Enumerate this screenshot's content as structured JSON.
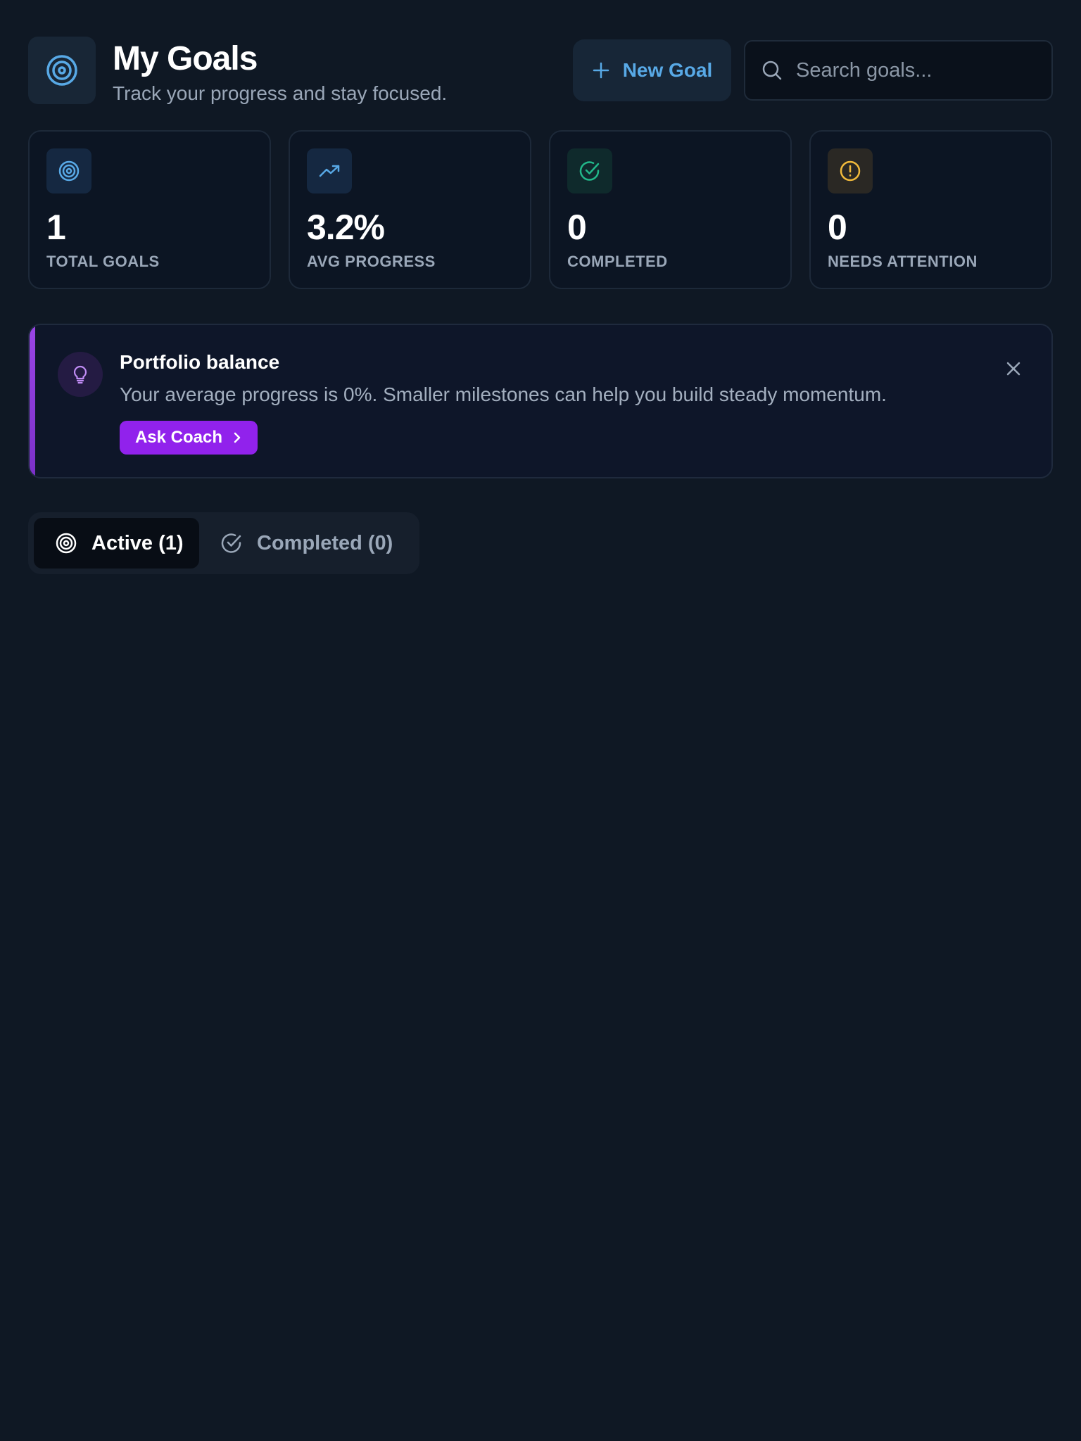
{
  "header": {
    "title": "My Goals",
    "subtitle": "Track your progress and stay focused.",
    "logo_icon": "target-icon",
    "new_goal_label": "New Goal",
    "search_placeholder": "Search goals..."
  },
  "stats": [
    {
      "icon": "target-icon",
      "value": "1",
      "label": "TOTAL GOALS",
      "color": "#58a9e6"
    },
    {
      "icon": "trending-up-icon",
      "value": "3.2%",
      "label": "AVG PROGRESS",
      "color": "#58a9e6"
    },
    {
      "icon": "check-circle-icon",
      "value": "0",
      "label": "COMPLETED",
      "color": "#22b88a"
    },
    {
      "icon": "alert-circle-icon",
      "value": "0",
      "label": "NEEDS ATTENTION",
      "color": "#f0b93b"
    }
  ],
  "insight": {
    "icon": "lightbulb-icon",
    "title": "Portfolio balance",
    "text": "Your average progress is 0%. Smaller milestones can help you build steady momentum.",
    "button_label": "Ask Coach",
    "accent_color": "#9122ec"
  },
  "tabs": [
    {
      "label": "Active (1)",
      "icon": "target-icon",
      "selected": true
    },
    {
      "label": "Completed (0)",
      "icon": "check-circle-icon",
      "selected": false
    }
  ],
  "colors": {
    "background": "#0f1824",
    "accent_blue": "#58a9e6",
    "accent_purple": "#9122ec"
  }
}
